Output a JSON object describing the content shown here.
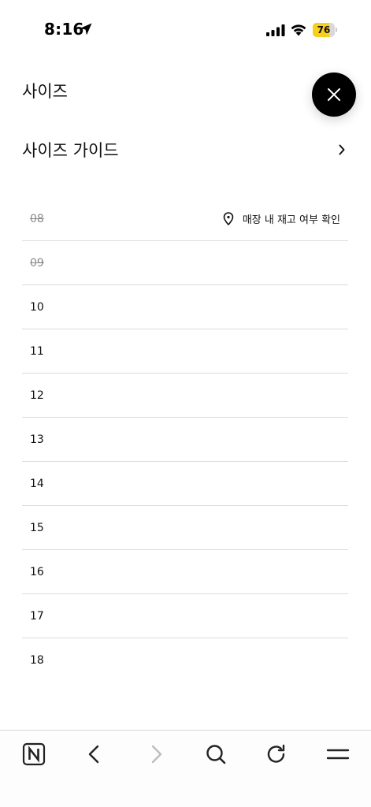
{
  "status_bar": {
    "time": "8:16",
    "battery_level": "76",
    "battery_fraction": 0.76,
    "battery_color": "#f7cf1d",
    "icons": [
      "location-arrow-icon",
      "cellular-signal-icon",
      "wifi-icon",
      "battery-icon"
    ]
  },
  "panel": {
    "title": "사이즈",
    "close_icon": "close-icon",
    "size_guide_label": "사이즈 가이드",
    "size_guide_icon": "chevron-right-icon"
  },
  "sizes": [
    {
      "label": "08",
      "available": false,
      "stock_check_label": "매장 내 재고 여부 확인"
    },
    {
      "label": "09",
      "available": false
    },
    {
      "label": "10",
      "available": true
    },
    {
      "label": "11",
      "available": true
    },
    {
      "label": "12",
      "available": true
    },
    {
      "label": "13",
      "available": true
    },
    {
      "label": "14",
      "available": true
    },
    {
      "label": "15",
      "available": true
    },
    {
      "label": "16",
      "available": true
    },
    {
      "label": "17",
      "available": true
    },
    {
      "label": "18",
      "available": true
    }
  ],
  "toolbar": {
    "buttons": [
      {
        "name": "home-n-icon",
        "enabled": true
      },
      {
        "name": "back-icon",
        "enabled": true
      },
      {
        "name": "forward-icon",
        "enabled": false
      },
      {
        "name": "search-icon",
        "enabled": true
      },
      {
        "name": "reload-icon",
        "enabled": true
      },
      {
        "name": "menu-icon",
        "enabled": true
      }
    ]
  }
}
